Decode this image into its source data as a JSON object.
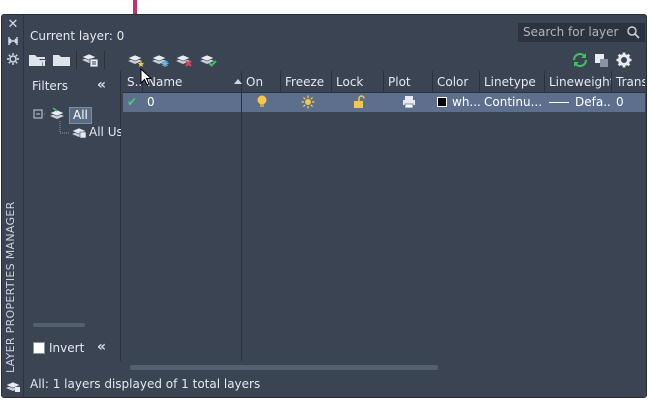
{
  "palette": {
    "vertical_title": "LAYER PROPERTIES MANAGER",
    "current_layer_label": "Current layer: 0",
    "search": {
      "placeholder": "Search for layer"
    }
  },
  "side_strip": {
    "icons": [
      "close-icon",
      "auto-hide-icon",
      "properties-icon",
      "layer-stack-icon"
    ]
  },
  "toolbar": {
    "left_icons": [
      "new-property-filter-icon",
      "new-group-filter-icon",
      "layer-states-manager-icon",
      "new-layer-icon",
      "new-layer-vp-frozen-icon",
      "delete-layer-icon",
      "set-current-icon"
    ],
    "right_icons": [
      "refresh-icon",
      "settings-icon"
    ]
  },
  "filters": {
    "title": "Filters",
    "collapse_glyph": "«",
    "tree": {
      "root": "All",
      "child": "All Used Layers"
    },
    "invert_label": "Invert",
    "invert_checked": false
  },
  "grid": {
    "columns": [
      "S..",
      "Name",
      "On",
      "Freeze",
      "Lock",
      "Plot",
      "Color",
      "Linetype",
      "Lineweight",
      "Trans"
    ],
    "rows": [
      {
        "status": "✔",
        "name": "0",
        "on": "bulb-on-icon",
        "freeze": "sun-thawed-icon",
        "lock": "unlocked-icon",
        "plot": "printer-icon",
        "color_name": "wh...",
        "color_hex": "#000000",
        "linetype": "Continu...",
        "lineweight": "Defa...",
        "transparency": "0"
      }
    ]
  },
  "status_bar": {
    "text": "All: 1 layers displayed of 1 total layers"
  },
  "colors": {
    "panel_bg": "#3b4453",
    "selected_row": "#5d6f8c",
    "annotation_arrow": "#c0307a",
    "bulb": "#f2c94c",
    "lock": "#f2c94c",
    "refresh": "#3fbf5f"
  }
}
